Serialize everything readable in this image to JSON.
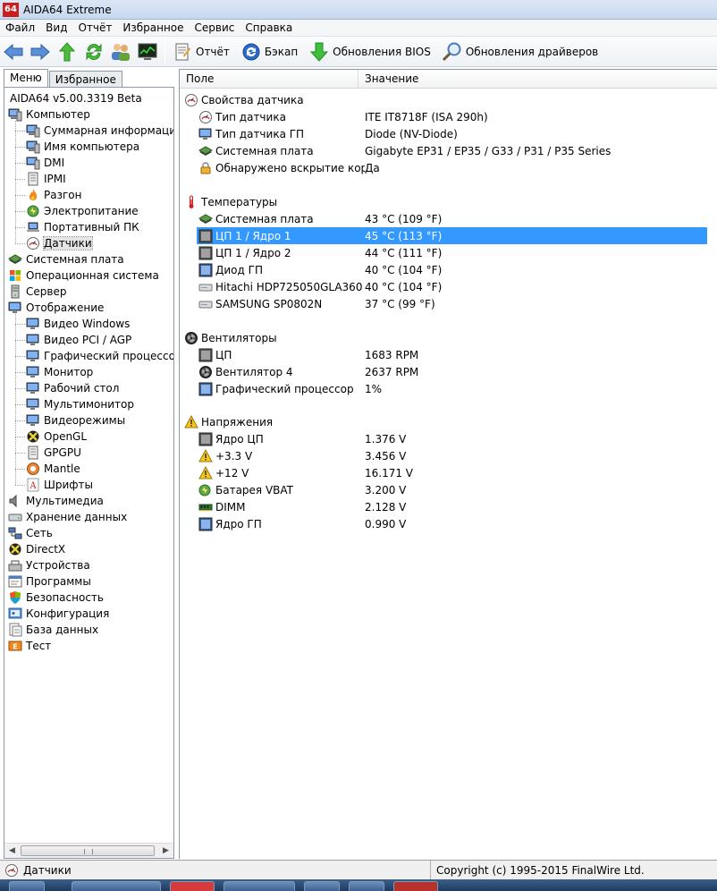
{
  "window": {
    "title": "AIDA64 Extreme",
    "logo_text": "64"
  },
  "menu": [
    "Файл",
    "Вид",
    "Отчёт",
    "Избранное",
    "Сервис",
    "Справка"
  ],
  "toolbar": {
    "report_label": "Отчёт",
    "backup_label": "Бэкап",
    "bios_label": "Обновления BIOS",
    "drivers_label": "Обновления драйверов"
  },
  "tabs": {
    "menu": "Меню",
    "favorites": "Избранное"
  },
  "tree": {
    "root": "AIDA64 v5.00.3319 Beta",
    "items": [
      {
        "label": "Компьютер",
        "level": 0
      },
      {
        "label": "Суммарная информация",
        "level": 1
      },
      {
        "label": "Имя компьютера",
        "level": 1
      },
      {
        "label": "DMI",
        "level": 1
      },
      {
        "label": "IPMI",
        "level": 1
      },
      {
        "label": "Разгон",
        "level": 1
      },
      {
        "label": "Электропитание",
        "level": 1
      },
      {
        "label": "Портативный ПК",
        "level": 1
      },
      {
        "label": "Датчики",
        "level": 1
      },
      {
        "label": "Системная плата",
        "level": 0
      },
      {
        "label": "Операционная система",
        "level": 0
      },
      {
        "label": "Сервер",
        "level": 0
      },
      {
        "label": "Отображение",
        "level": 0
      },
      {
        "label": "Видео Windows",
        "level": 1
      },
      {
        "label": "Видео PCI / AGP",
        "level": 1
      },
      {
        "label": "Графический процессор",
        "level": 1
      },
      {
        "label": "Монитор",
        "level": 1
      },
      {
        "label": "Рабочий стол",
        "level": 1
      },
      {
        "label": "Мультимонитор",
        "level": 1
      },
      {
        "label": "Видеорежимы",
        "level": 1
      },
      {
        "label": "OpenGL",
        "level": 1
      },
      {
        "label": "GPGPU",
        "level": 1
      },
      {
        "label": "Mantle",
        "level": 1
      },
      {
        "label": "Шрифты",
        "level": 1
      },
      {
        "label": "Мультимедиа",
        "level": 0
      },
      {
        "label": "Хранение данных",
        "level": 0
      },
      {
        "label": "Сеть",
        "level": 0
      },
      {
        "label": "DirectX",
        "level": 0
      },
      {
        "label": "Устройства",
        "level": 0
      },
      {
        "label": "Программы",
        "level": 0
      },
      {
        "label": "Безопасность",
        "level": 0
      },
      {
        "label": "Конфигурация",
        "level": 0
      },
      {
        "label": "База данных",
        "level": 0
      },
      {
        "label": "Тест",
        "level": 0
      }
    ]
  },
  "columns": {
    "field": "Поле",
    "value": "Значение"
  },
  "groups": [
    {
      "title": "Свойства датчика",
      "rows": [
        {
          "field": "Тип датчика",
          "value": "ITE IT8718F  (ISA 290h)"
        },
        {
          "field": "Тип датчика ГП",
          "value": "Diode  (NV-Diode)"
        },
        {
          "field": "Системная плата",
          "value": "Gigabyte EP31 / EP35 / G33 / P31 / P35 Series"
        },
        {
          "field": "Обнаружено вскрытие кор...",
          "value": "Да"
        }
      ]
    },
    {
      "title": "Температуры",
      "rows": [
        {
          "field": "Системная плата",
          "value": "43 °C  (109 °F)"
        },
        {
          "field": "ЦП 1 / Ядро 1",
          "value": "45 °C  (113 °F)"
        },
        {
          "field": "ЦП 1 / Ядро 2",
          "value": "44 °C  (111 °F)"
        },
        {
          "field": "Диод ГП",
          "value": "40 °C  (104 °F)"
        },
        {
          "field": "Hitachi HDP725050GLA360",
          "value": "40 °C  (104 °F)"
        },
        {
          "field": "SAMSUNG SP0802N",
          "value": "37 °C  (99 °F)"
        }
      ]
    },
    {
      "title": "Вентиляторы",
      "rows": [
        {
          "field": "ЦП",
          "value": "1683 RPM"
        },
        {
          "field": "Вентилятор 4",
          "value": "2637 RPM"
        },
        {
          "field": "Графический процессор",
          "value": "1%"
        }
      ]
    },
    {
      "title": "Напряжения",
      "rows": [
        {
          "field": "Ядро ЦП",
          "value": "1.376 V"
        },
        {
          "field": "+3.3 V",
          "value": "3.456 V"
        },
        {
          "field": "+12 V",
          "value": "16.171 V"
        },
        {
          "field": "Батарея VBAT",
          "value": "3.200 V"
        },
        {
          "field": "DIMM",
          "value": "2.128 V"
        },
        {
          "field": "Ядро ГП",
          "value": "0.990 V"
        }
      ]
    }
  ],
  "status": {
    "left": "Датчики",
    "right": "Copyright (c) 1995-2015 FinalWire Ltd."
  },
  "colors": {
    "selection": "#3399ff",
    "accent": "#c8201e"
  }
}
